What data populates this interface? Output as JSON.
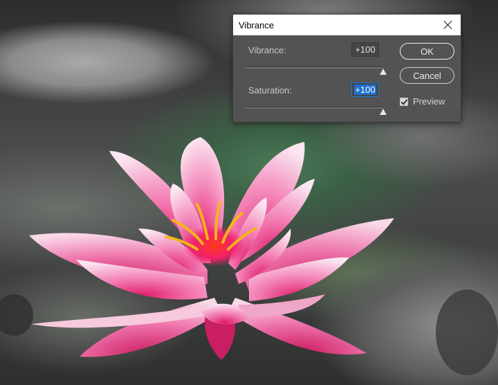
{
  "dialog": {
    "title": "Vibrance",
    "close_icon": "close-icon",
    "vibrance": {
      "label": "Vibrance:",
      "value": "+100",
      "slider_fraction": 1.0
    },
    "saturation": {
      "label": "Saturation:",
      "value": "+100",
      "slider_fraction": 1.0
    },
    "ok_label": "OK",
    "cancel_label": "Cancel",
    "preview_label": "Preview",
    "preview_checked": true
  },
  "colors": {
    "dialog_bg": "#535353",
    "titlebar_bg": "#ffffff",
    "focus_blue": "#1f6fd1",
    "flower_pink": "#f06aa8",
    "stamen_yellow": "#f5b51b"
  }
}
